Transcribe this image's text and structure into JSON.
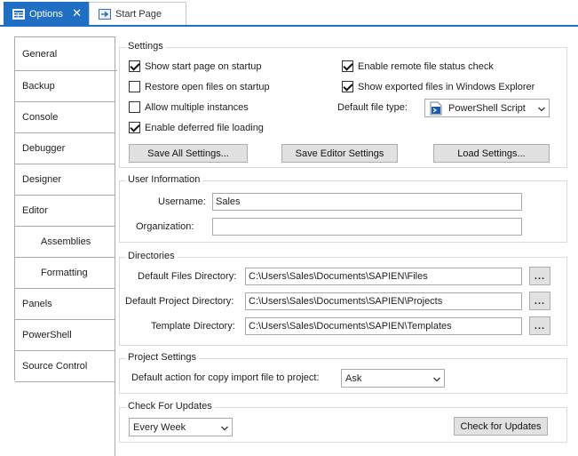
{
  "tabs": [
    {
      "label": "Options",
      "icon": "options-icon",
      "active": true
    },
    {
      "label": "Start Page",
      "icon": "start-page-icon",
      "active": false
    }
  ],
  "colors": {
    "accent": "#1f6fc5",
    "border": "#a9a9a9",
    "button": "#e1e1e1"
  },
  "nav": {
    "items": [
      {
        "label": "General",
        "selected": true
      },
      {
        "label": "Backup"
      },
      {
        "label": "Console"
      },
      {
        "label": "Debugger"
      },
      {
        "label": "Designer"
      },
      {
        "label": "Editor"
      },
      {
        "label": "Assemblies",
        "sub": true
      },
      {
        "label": "Formatting",
        "sub": true
      },
      {
        "label": "Panels"
      },
      {
        "label": "PowerShell"
      },
      {
        "label": "Source Control"
      }
    ]
  },
  "settings": {
    "title": "Settings",
    "checks": [
      {
        "label": "Show start page on startup",
        "checked": true
      },
      {
        "label": "Restore open files on startup",
        "checked": false
      },
      {
        "label": "Allow multiple instances",
        "checked": false
      },
      {
        "label": "Enable deferred file loading",
        "checked": true
      },
      {
        "label": "Enable remote file status check",
        "checked": true
      },
      {
        "label": "Show exported files in Windows Explorer",
        "checked": true
      }
    ],
    "default_file_type_label": "Default file type:",
    "default_file_type_value": "PowerShell Script",
    "buttons": {
      "save_all": "Save All Settings...",
      "save_editor": "Save Editor Settings",
      "load": "Load Settings..."
    }
  },
  "user_info": {
    "title": "User Information",
    "username_label": "Username:",
    "username_value": "Sales",
    "organization_label": "Organization:",
    "organization_value": ""
  },
  "directories": {
    "title": "Directories",
    "browse_label": "...",
    "rows": [
      {
        "label": "Default Files Directory:",
        "value": "C:\\Users\\Sales\\Documents\\SAPIEN\\Files"
      },
      {
        "label": "Default Project Directory:",
        "value": "C:\\Users\\Sales\\Documents\\SAPIEN\\Projects"
      },
      {
        "label": "Template Directory:",
        "value": "C:\\Users\\Sales\\Documents\\SAPIEN\\Templates"
      }
    ]
  },
  "project_settings": {
    "title": "Project Settings",
    "label": "Default action for copy import file to project:",
    "value": "Ask"
  },
  "updates": {
    "title": "Check For Updates",
    "frequency": "Every Week",
    "button": "Check for Updates"
  }
}
